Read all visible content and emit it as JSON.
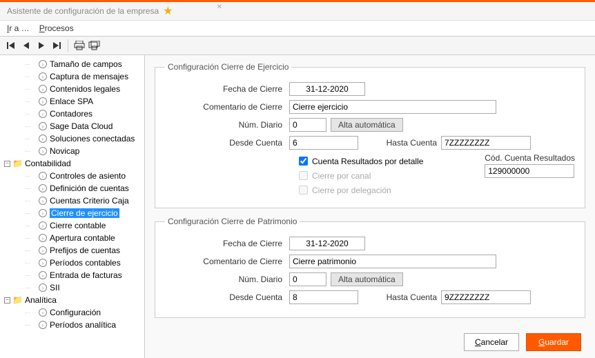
{
  "title": "Asistente de configuración de la empresa",
  "menu": {
    "ir_a": "Ir a …",
    "procesos": "Procesos"
  },
  "tree": {
    "items_top": [
      "Tamaño de campos",
      "Captura de mensajes",
      "Contenidos legales",
      "Enlace SPA",
      "Contadores",
      "Sage Data Cloud",
      "Soluciones conectadas",
      "Novicap"
    ],
    "contabilidad": "Contabilidad",
    "items_contab": [
      "Controles de asiento",
      "Definición de cuentas",
      "Cuentas Criterio Caja",
      "Cierre de ejercicio",
      "Cierre contable",
      "Apertura contable",
      "Prefijos de cuentas",
      "Períodos contables",
      "Entrada de facturas",
      "SII"
    ],
    "analitica": "Analítica",
    "items_analitica": [
      "Configuración",
      "Períodos analítica"
    ],
    "selected": "Cierre de ejercicio"
  },
  "group1": {
    "legend": "Configuración Cierre de Ejercicio",
    "fecha_lbl": "Fecha de Cierre",
    "fecha_val": "31-12-2020",
    "comentario_lbl": "Comentario de Cierre",
    "comentario_val": "Cierre ejercicio",
    "numdiario_lbl": "Núm. Diario",
    "numdiario_val": "0",
    "alta_btn": "Alta automática",
    "desde_lbl": "Desde Cuenta",
    "desde_val": "6",
    "hasta_lbl": "Hasta Cuenta",
    "hasta_val": "7ZZZZZZZZ",
    "chk1": "Cuenta Resultados por detalle",
    "chk2": "Cierre por canal",
    "chk3": "Cierre por delegación",
    "cod_lbl": "Cód. Cuenta Resultados",
    "cod_val": "129000000"
  },
  "group2": {
    "legend": "Configuración Cierre de Patrimonio",
    "fecha_lbl": "Fecha de Cierre",
    "fecha_val": "31-12-2020",
    "comentario_lbl": "Comentario de Cierre",
    "comentario_val": "Cierre patrimonio",
    "numdiario_lbl": "Núm. Diario",
    "numdiario_val": "0",
    "alta_btn": "Alta automática",
    "desde_lbl": "Desde Cuenta",
    "desde_val": "8",
    "hasta_lbl": "Hasta Cuenta",
    "hasta_val": "9ZZZZZZZZ"
  },
  "buttons": {
    "cancel": "Cancelar",
    "save": "Guardar"
  }
}
